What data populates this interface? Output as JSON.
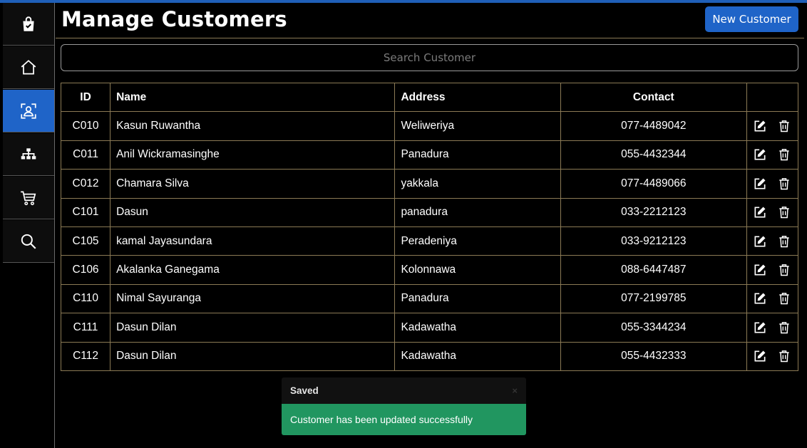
{
  "page": {
    "title": "Manage Customers",
    "new_button": "New Customer"
  },
  "search": {
    "placeholder": "Search Customer"
  },
  "sidebar": {
    "items": [
      {
        "name": "shop-bag-icon",
        "active": false
      },
      {
        "name": "home-icon",
        "active": false
      },
      {
        "name": "customer-icon",
        "active": true
      },
      {
        "name": "org-chart-icon",
        "active": false
      },
      {
        "name": "cart-icon",
        "active": false
      },
      {
        "name": "search-icon",
        "active": false
      }
    ]
  },
  "table": {
    "headers": {
      "id": "ID",
      "name": "Name",
      "address": "Address",
      "contact": "Contact"
    },
    "rows": [
      {
        "id": "C010",
        "name": "Kasun Ruwantha",
        "address": "Weliweriya",
        "contact": "077-4489042"
      },
      {
        "id": "C011",
        "name": "Anil Wickramasinghe",
        "address": "Panadura",
        "contact": "055-4432344"
      },
      {
        "id": "C012",
        "name": "Chamara Silva",
        "address": "yakkala",
        "contact": "077-4489066"
      },
      {
        "id": "C101",
        "name": "Dasun",
        "address": "panadura",
        "contact": "033-2212123"
      },
      {
        "id": "C105",
        "name": "kamal Jayasundara",
        "address": "Peradeniya",
        "contact": "033-9212123"
      },
      {
        "id": "C106",
        "name": "Akalanka Ganegama",
        "address": "Kolonnawa",
        "contact": "088-6447487"
      },
      {
        "id": "C110",
        "name": "Nimal Sayuranga",
        "address": "Panadura",
        "contact": "077-2199785"
      },
      {
        "id": "C111",
        "name": "Dasun Dilan",
        "address": "Kadawatha",
        "contact": "055-3344234"
      },
      {
        "id": "C112",
        "name": "Dasun Dilan",
        "address": "Kadawatha",
        "contact": "055-4432333"
      }
    ]
  },
  "toast": {
    "title": "Saved",
    "close": "×",
    "message": "Customer has been updated successfully"
  },
  "colors": {
    "accent": "#1f64c8",
    "success": "#219660",
    "border": "#8b7a55"
  }
}
